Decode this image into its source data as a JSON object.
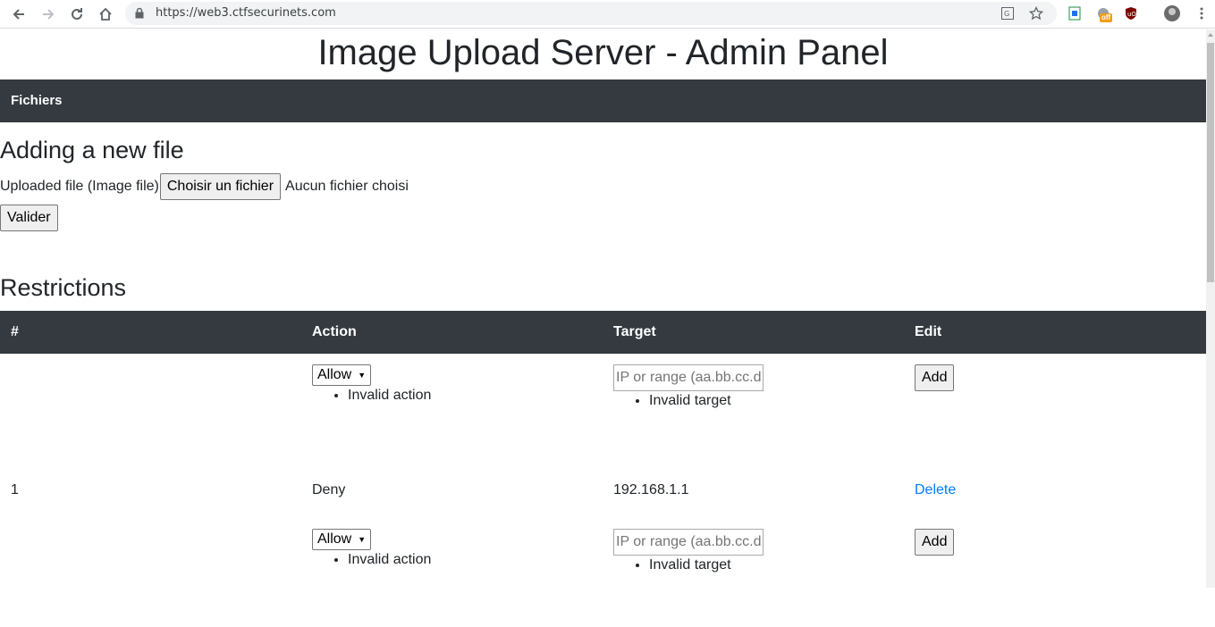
{
  "browser": {
    "url": "https://web3.ctfsecurinets.com",
    "extension_badge": "off"
  },
  "page": {
    "title": "Image Upload Server - Admin Panel",
    "nav": {
      "files_link": "Fichiers"
    },
    "upload_section": {
      "heading": "Adding a new file",
      "field_label": "Uploaded file (Image file)",
      "choose_button": "Choisir un fichier",
      "no_file_text": "Aucun fichier choisi",
      "submit_button": "Valider"
    },
    "restrictions": {
      "heading": "Restrictions",
      "columns": [
        "#",
        "Action",
        "Target",
        "Edit"
      ],
      "form_top": {
        "action_selected": "Allow",
        "action_error": "Invalid action",
        "target_placeholder": "IP or range (aa.bb.cc.dd)",
        "target_error": "Invalid target",
        "add_button": "Add"
      },
      "rows": [
        {
          "id": "1",
          "action": "Deny",
          "target": "192.168.1.1",
          "edit": "Delete"
        }
      ],
      "form_bottom": {
        "action_selected": "Allow",
        "action_error": "Invalid action",
        "target_placeholder": "IP or range (aa.bb.cc.dd)",
        "target_error": "Invalid target",
        "add_button": "Add"
      }
    }
  },
  "icons": [
    "back-arrow-icon",
    "forward-arrow-icon",
    "reload-icon",
    "home-icon",
    "lock-icon",
    "translate-icon",
    "star-icon",
    "extension-icon",
    "profile-avatar-icon",
    "menu-dots-icon"
  ]
}
